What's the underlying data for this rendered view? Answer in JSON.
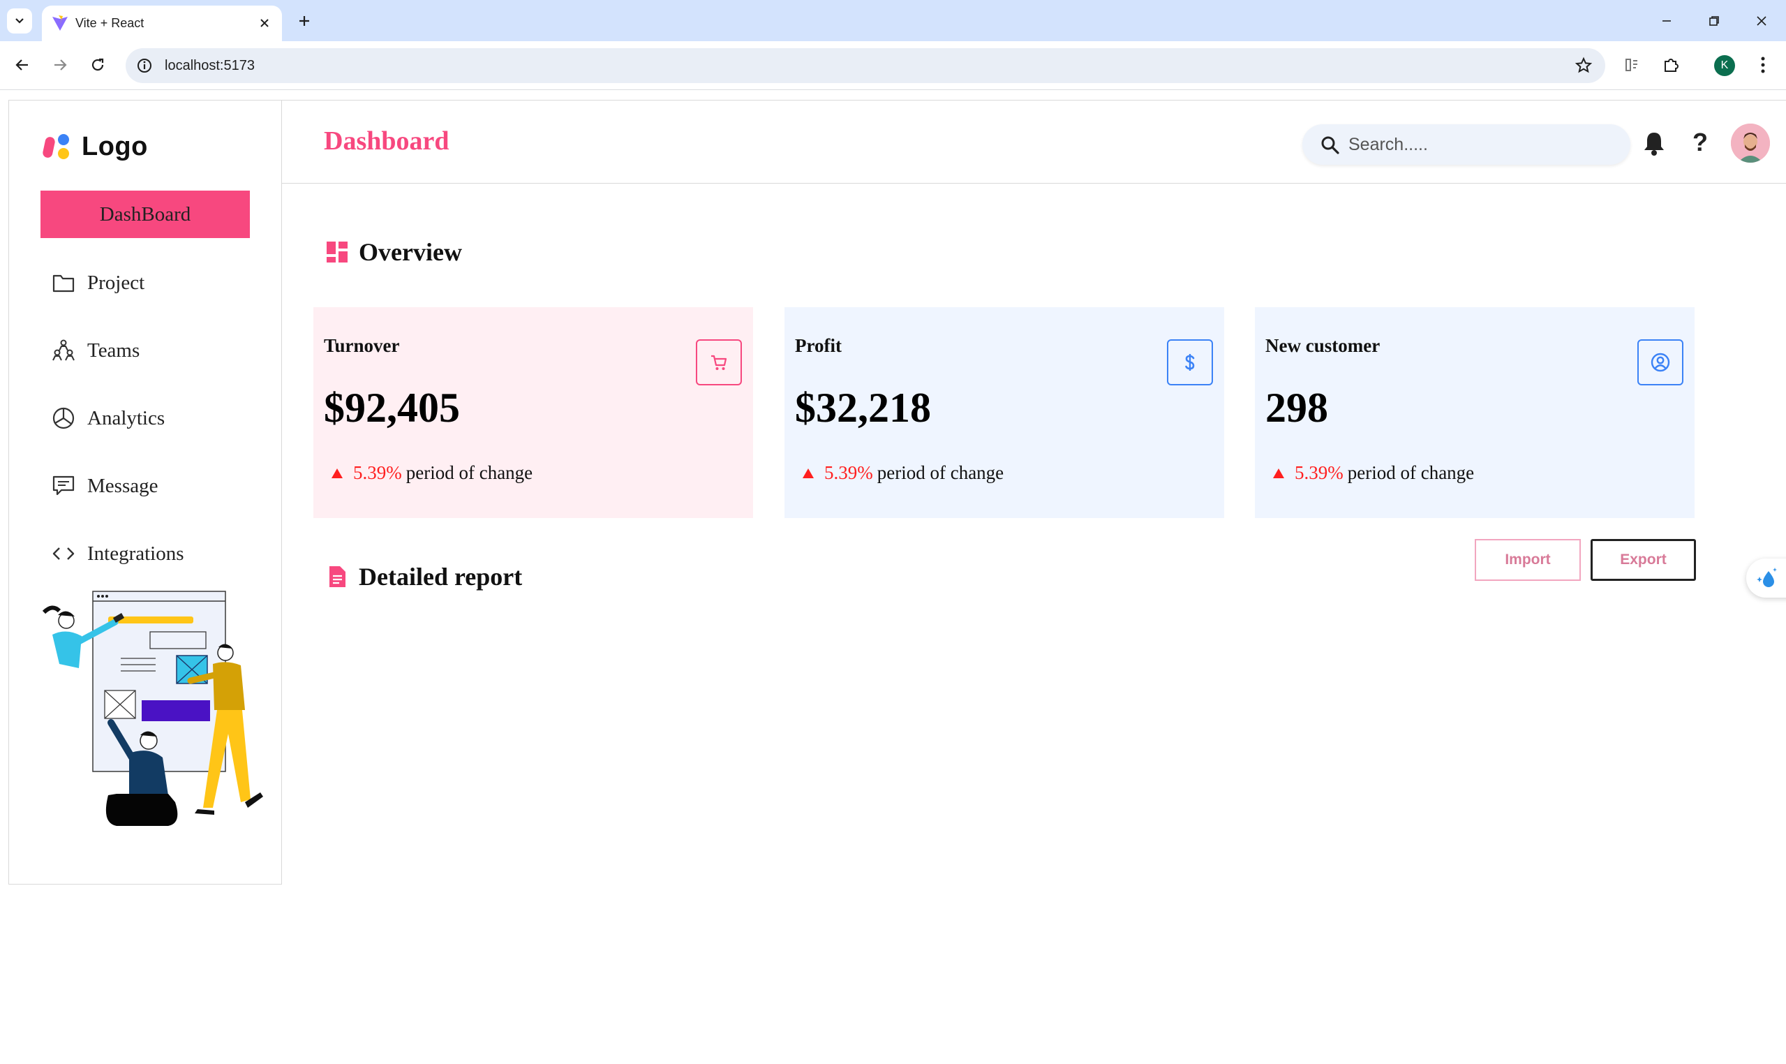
{
  "browser": {
    "tab_title": "Vite + React",
    "url": "localhost:5173",
    "profile_initial": "K"
  },
  "sidebar": {
    "logo_text": "Logo",
    "active_item": "DashBoard",
    "items": [
      {
        "label": "Project",
        "icon": "folder-icon"
      },
      {
        "label": "Teams",
        "icon": "teams-icon"
      },
      {
        "label": "Analytics",
        "icon": "pie-chart-icon"
      },
      {
        "label": "Message",
        "icon": "message-icon"
      },
      {
        "label": "Integrations",
        "icon": "code-icon"
      }
    ]
  },
  "header": {
    "title": "Dashboard",
    "search_placeholder": "Search.....",
    "help_symbol": "?"
  },
  "overview": {
    "title": "Overview",
    "cards": [
      {
        "title": "Turnover",
        "value": "$92,405",
        "change_pct": "5.39%",
        "change_text": "period of change",
        "icon": "cart-icon",
        "bg": "#ffeff3",
        "accent": "#f7487f"
      },
      {
        "title": "Profit",
        "value": "$32,218",
        "change_pct": "5.39%",
        "change_text": "period of change",
        "icon": "dollar-icon",
        "bg": "#eff5ff",
        "accent": "#3b82f6"
      },
      {
        "title": "New customer",
        "value": "298",
        "change_pct": "5.39%",
        "change_text": "period of change",
        "icon": "user-circle-icon",
        "bg": "#eff5ff",
        "accent": "#3b82f6"
      }
    ]
  },
  "report": {
    "title": "Detailed report",
    "import_label": "Import",
    "export_label": "Export"
  },
  "colors": {
    "brand_pink": "#f7487f",
    "change_red": "#ff1f1f"
  }
}
